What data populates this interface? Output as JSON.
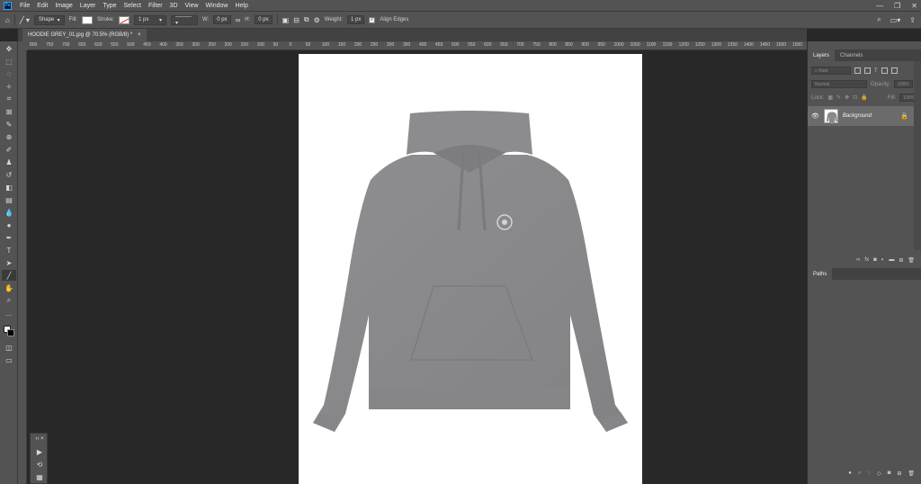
{
  "app": {
    "logo": "Ps"
  },
  "menu": [
    "File",
    "Edit",
    "Image",
    "Layer",
    "Type",
    "Select",
    "Filter",
    "3D",
    "View",
    "Window",
    "Help"
  ],
  "window_controls": {
    "minimize": "—",
    "maximize": "❐",
    "close": "✕"
  },
  "options_bar": {
    "home_icon": "home-icon",
    "tool_mode": "Shape",
    "fill_label": "Fill:",
    "stroke_label": "Stroke:",
    "stroke_width": "1 px",
    "w_label": "W:",
    "w_value": "0 px",
    "h_label": "H:",
    "h_value": "0 px",
    "weight_label": "Weight:",
    "weight_value": "1 px",
    "align_edges_label": "Align Edges",
    "align_edges_checked": true
  },
  "document_tab": {
    "title": "HOODIE GREY_01.jpg @ 70.5% (RGB/8) *",
    "close": "×"
  },
  "ruler_top_labels": [
    "800",
    "750",
    "700",
    "650",
    "600",
    "550",
    "500",
    "450",
    "400",
    "350",
    "300",
    "250",
    "200",
    "150",
    "100",
    "50",
    "0",
    "50",
    "100",
    "150",
    "200",
    "250",
    "300",
    "350",
    "400",
    "450",
    "500",
    "550",
    "600",
    "650",
    "700",
    "750",
    "800",
    "850",
    "900",
    "950",
    "1000",
    "1050",
    "1100",
    "1150",
    "1200",
    "1250",
    "1300",
    "1350",
    "1400",
    "1450",
    "1500",
    "1550"
  ],
  "layers_panel": {
    "tabs": [
      "Layers",
      "Channels"
    ],
    "filter_placeholder": "Kind",
    "blend_mode": "Normal",
    "opacity_label": "Opacity:",
    "opacity_value": "100%",
    "lock_label": "Lock:",
    "fill_label": "Fill:",
    "fill_value": "100%",
    "layer_name": "Background"
  },
  "paths_panel": {
    "tabs": [
      "Paths"
    ]
  },
  "colors": {
    "accent": "#31a8ff",
    "panel_bg": "#535353",
    "canvas_bg": "#282828",
    "hoodie": "#8a8a8c"
  }
}
